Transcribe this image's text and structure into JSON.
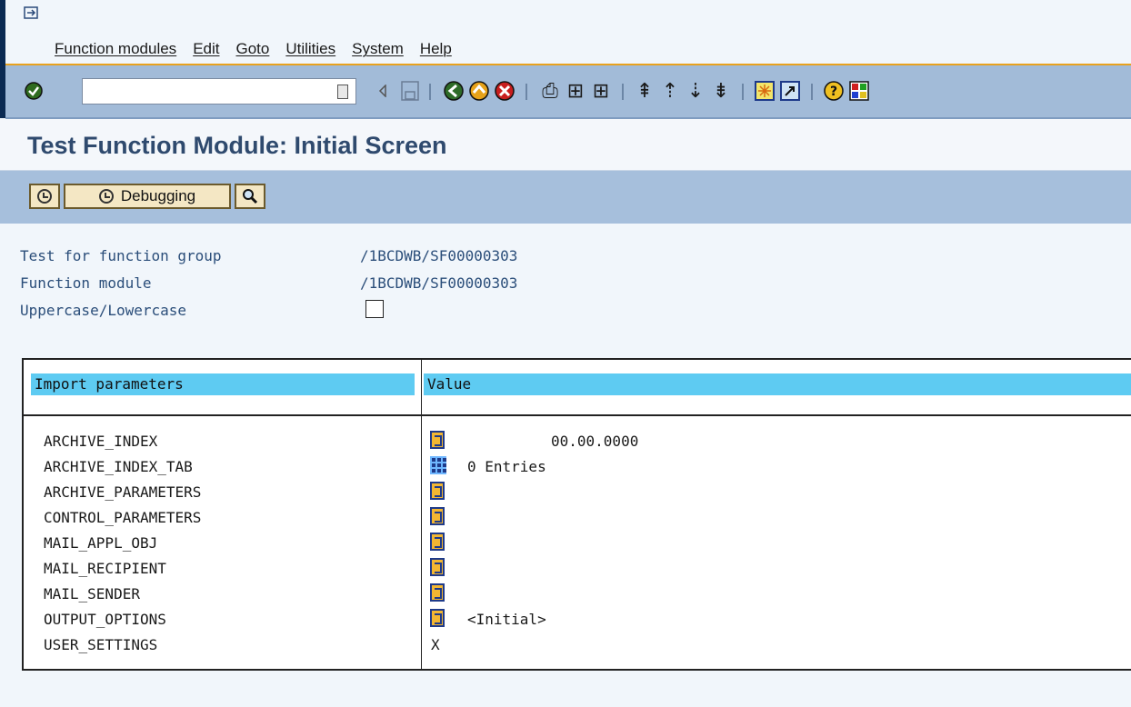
{
  "menu": {
    "items": [
      "Function modules",
      "Edit",
      "Goto",
      "Utilities",
      "System",
      "Help"
    ]
  },
  "toolbar": {
    "command_value": "",
    "icons": [
      "enter-icon",
      "back-icon",
      "save-icon",
      "back-green-icon",
      "exit-icon",
      "cancel-icon",
      "print-icon",
      "find-icon",
      "find-next-icon",
      "first-page-icon",
      "previous-page-icon",
      "next-page-icon",
      "last-page-icon",
      "create-session-icon",
      "shortcut-icon",
      "help-icon",
      "layout-icon"
    ]
  },
  "title": "Test Function Module: Initial Screen",
  "app_toolbar": {
    "debugging_label": "Debugging"
  },
  "info": {
    "group_label": "Test for function group",
    "group_value": "/1BCDWB/SF00000303",
    "module_label": "Function module",
    "module_value": "/1BCDWB/SF00000303",
    "case_label": "Uppercase/Lowercase"
  },
  "table": {
    "col_param": "Import parameters",
    "col_value": "Value",
    "rows": [
      {
        "name": "ARCHIVE_INDEX",
        "icon": "edit-icon",
        "value": "00.00.0000"
      },
      {
        "name": "ARCHIVE_INDEX_TAB",
        "icon": "table-icon",
        "value": "0 Entries"
      },
      {
        "name": "ARCHIVE_PARAMETERS",
        "icon": "edit-icon",
        "value": ""
      },
      {
        "name": "CONTROL_PARAMETERS",
        "icon": "edit-icon",
        "value": ""
      },
      {
        "name": "MAIL_APPL_OBJ",
        "icon": "edit-icon",
        "value": ""
      },
      {
        "name": "MAIL_RECIPIENT",
        "icon": "edit-icon",
        "value": ""
      },
      {
        "name": "MAIL_SENDER",
        "icon": "edit-icon",
        "value": ""
      },
      {
        "name": "OUTPUT_OPTIONS",
        "icon": "edit-icon",
        "value": "<Initial>"
      },
      {
        "name": "USER_SETTINGS",
        "icon": "",
        "value": "X"
      }
    ]
  },
  "colors": {
    "toolbar_bg": "#a2bbd8",
    "header_cyan": "#5ecbf2",
    "accent_orange": "#e8a21e",
    "title_color": "#2f4a6e"
  }
}
